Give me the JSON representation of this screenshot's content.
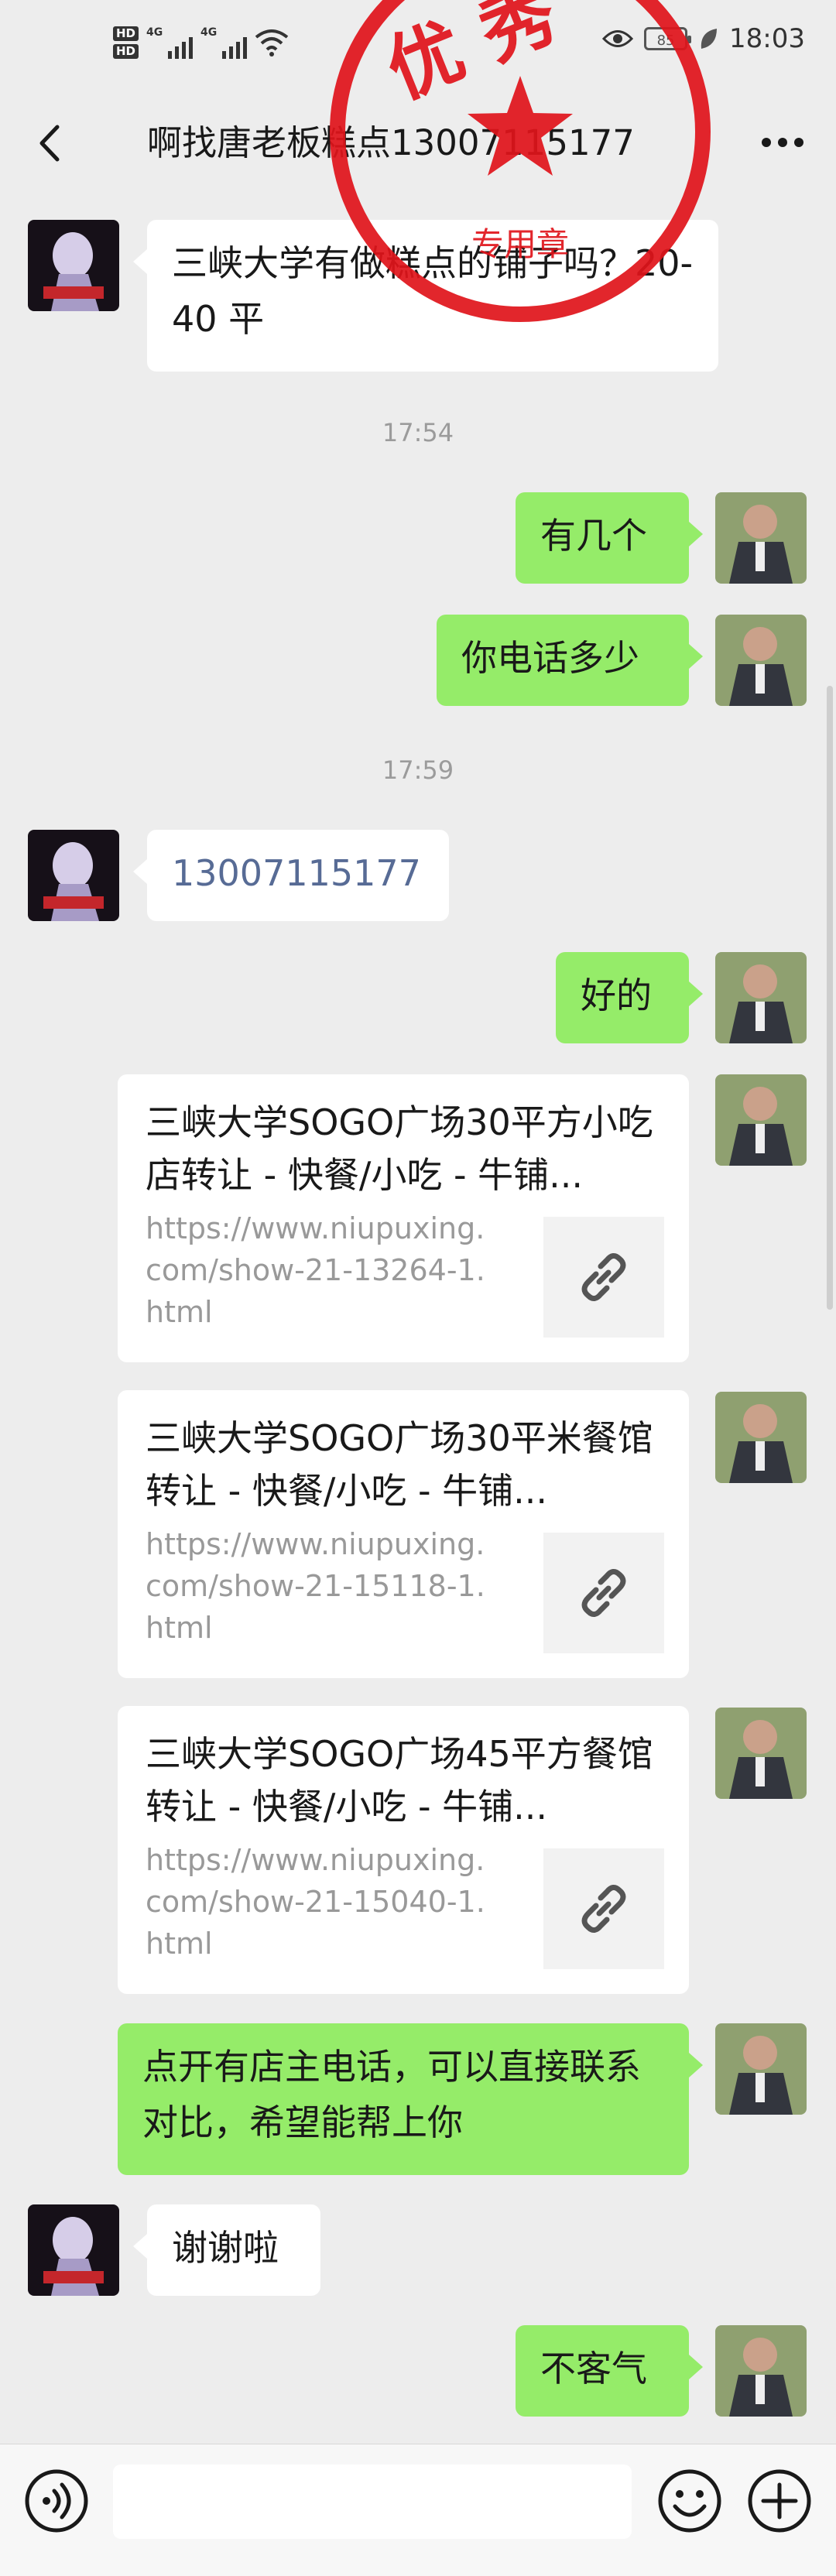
{
  "status_bar": {
    "hd1": "HD",
    "hd2": "HD",
    "net1": "4G",
    "net2": "4G",
    "battery": "85",
    "time": "18:03"
  },
  "header": {
    "title": "啊找唐老板糕点13007115177"
  },
  "stamp": {
    "top_text": "优 秀",
    "bottom_text": "专用章"
  },
  "messages": {
    "m1": "三峡大学有做糕点的铺子吗？20-40 平",
    "t1": "17:54",
    "m2": "有几个",
    "m3": "你电话多少",
    "t2": "17:59",
    "m4": "13007115177",
    "m5": "好的",
    "link1": {
      "title": "三峡大学SOGO广场30平方小吃店转让 - 快餐/小吃 - 牛铺...",
      "url": "https://www.niupuxing.com/show-21-13264-1.html"
    },
    "link2": {
      "title": "三峡大学SOGO广场30平米餐馆转让 - 快餐/小吃 - 牛铺...",
      "url": "https://www.niupuxing.com/show-21-15118-1.html"
    },
    "link3": {
      "title": "三峡大学SOGO广场45平方餐馆转让 - 快餐/小吃 - 牛铺...",
      "url": "https://www.niupuxing.com/show-21-15040-1.html"
    },
    "m6": "点开有店主电话，可以直接联系对比，希望能帮上你",
    "m7": "谢谢啦",
    "m8": "不客气"
  },
  "colors": {
    "background": "#ededed",
    "sent_bubble": "#95ec69",
    "received_bubble": "#ffffff",
    "phone_link": "#576b95",
    "stamp_red": "#e0141b"
  },
  "icons": {
    "back": "chevron-left-icon",
    "more": "more-dots-icon",
    "link": "link-icon",
    "voice": "voice-icon",
    "emoji": "emoji-icon",
    "plus": "plus-icon"
  }
}
